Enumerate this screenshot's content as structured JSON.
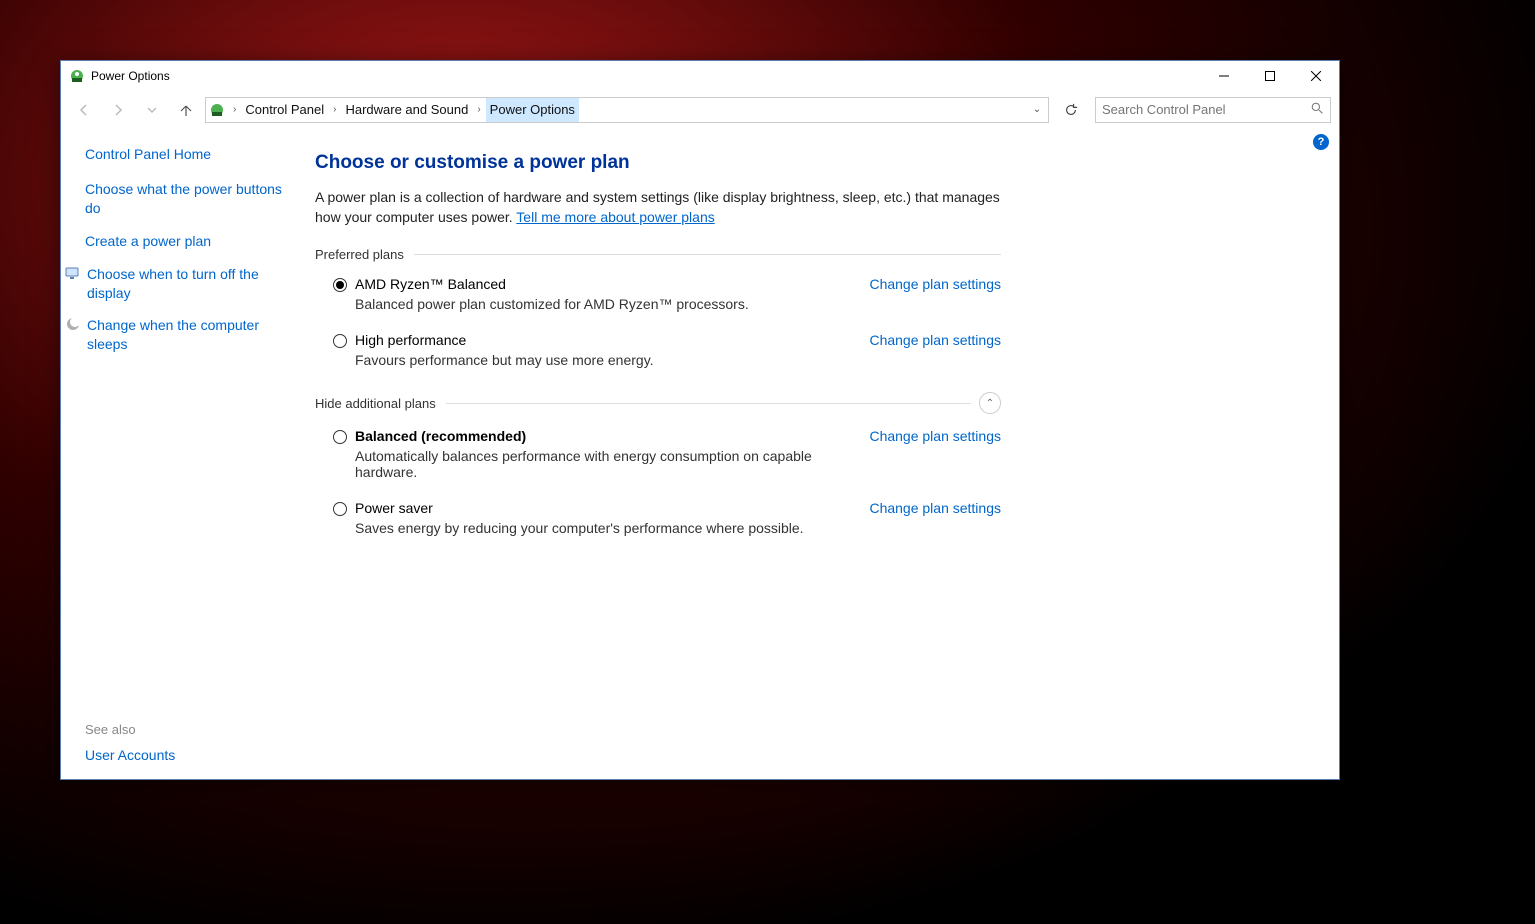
{
  "window": {
    "title": "Power Options"
  },
  "breadcrumb": {
    "items": [
      "Control Panel",
      "Hardware and Sound",
      "Power Options"
    ]
  },
  "search": {
    "placeholder": "Search Control Panel"
  },
  "sidebar": {
    "home": "Control Panel Home",
    "links": [
      "Choose what the power buttons do",
      "Create a power plan",
      "Choose when to turn off the display",
      "Change when the computer sleeps"
    ],
    "see_also_label": "See also",
    "see_also_links": [
      "User Accounts"
    ]
  },
  "main": {
    "heading": "Choose or customise a power plan",
    "intro_text": "A power plan is a collection of hardware and system settings (like display brightness, sleep, etc.) that manages how your computer uses power. ",
    "intro_link": "Tell me more about power plans",
    "preferred_label": "Preferred plans",
    "additional_label": "Hide additional plans",
    "change_link": "Change plan settings",
    "plans_preferred": [
      {
        "name": "AMD Ryzen™ Balanced",
        "desc": "Balanced power plan customized for AMD Ryzen™ processors.",
        "selected": true,
        "bold": false
      },
      {
        "name": "High performance",
        "desc": "Favours performance but may use more energy.",
        "selected": false,
        "bold": false
      }
    ],
    "plans_additional": [
      {
        "name": "Balanced (recommended)",
        "desc": "Automatically balances performance with energy consumption on capable hardware.",
        "selected": false,
        "bold": true
      },
      {
        "name": "Power saver",
        "desc": "Saves energy by reducing your computer's performance where possible.",
        "selected": false,
        "bold": false
      }
    ]
  }
}
